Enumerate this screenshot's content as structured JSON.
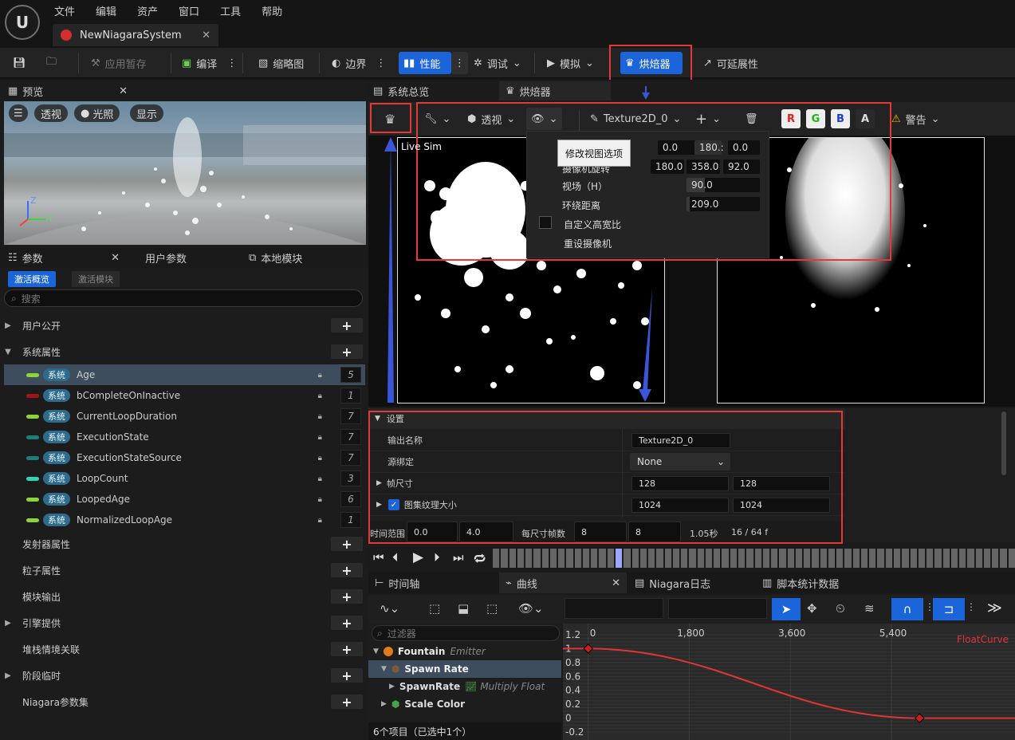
{
  "menubar": {
    "items": [
      "文件",
      "编辑",
      "资产",
      "窗口",
      "工具",
      "帮助"
    ],
    "doc_tab": "NewNiagaraSystem"
  },
  "toolbar": {
    "apply_cache": "应用暂存",
    "compile": "编译",
    "thumbnail": "缩略图",
    "bounds": "边界",
    "performance": "性能",
    "debug": "调试",
    "simulate": "模拟",
    "baker": "烘焙器",
    "scalability": "可延展性"
  },
  "preview": {
    "tab": "预览",
    "perspective": "透视",
    "lighting": "光照",
    "show": "显示",
    "axis_z": "Z",
    "axis_y": "Y"
  },
  "params": {
    "tabs": [
      "参数",
      "用户参数",
      "本地模块"
    ],
    "sub_tabs": [
      "激活概览",
      "激活模块"
    ],
    "search_placeholder": "搜索",
    "categories_top": [
      "用户公开",
      "系统属性"
    ],
    "tag": "系统",
    "rows": [
      {
        "name": "Age",
        "value": "5",
        "color": "#8ed23a"
      },
      {
        "name": "bCompleteOnInactive",
        "value": "1",
        "color": "#a3141a"
      },
      {
        "name": "CurrentLoopDuration",
        "value": "7",
        "color": "#8ed23a"
      },
      {
        "name": "ExecutionState",
        "value": "7",
        "color": "#1e7d78"
      },
      {
        "name": "ExecutionStateSource",
        "value": "7",
        "color": "#1e7d78"
      },
      {
        "name": "LoopCount",
        "value": "3",
        "color": "#2fd6b4"
      },
      {
        "name": "LoopedAge",
        "value": "6",
        "color": "#8ed23a"
      },
      {
        "name": "NormalizedLoopAge",
        "value": "1",
        "color": "#8ed23a"
      }
    ],
    "categories_bottom": [
      "发射器属性",
      "粒子属性",
      "模块输出",
      "引擎提供",
      "堆栈情境关联",
      "阶段临时",
      "Niagara参数集"
    ]
  },
  "viewtabs": {
    "overview": "系统总览",
    "baker": "烘焙器"
  },
  "baker_toolbar": {
    "perspective": "透视",
    "texture": "Texture2D_0",
    "channels": [
      "R",
      "G",
      "B",
      "A"
    ],
    "warning": "警告",
    "live_sim": "Live Sim"
  },
  "popup": {
    "tooltip": "修改视图选项",
    "cam_pos": [
      "0.0",
      "180.:",
      "0.0"
    ],
    "cam_rot_label": "摄像机旋转",
    "cam_rot": [
      "180.0",
      "358.0",
      "92.0"
    ],
    "fov_label": "视场（H）",
    "fov_value": "90.0",
    "fov_fill": 0.25,
    "orbit_label": "环绕距离",
    "orbit_value": "209.0",
    "orbit_fill": 0.04,
    "aspect_label": "自定义高宽比",
    "reset_label": "重设摄像机"
  },
  "settings": {
    "section": "设置",
    "output_name_label": "输出名称",
    "output_name": "Texture2D_0",
    "source_label": "源绑定",
    "source_value": "None",
    "frame_size_label": "帧尺寸",
    "frame_w": "128",
    "frame_h": "128",
    "atlas_label": "图集纹理大小",
    "atlas_w": "1024",
    "atlas_h": "1024",
    "time_label": "时间范围",
    "time_start": "0.0",
    "time_end": "4.0",
    "frames_label": "每尺寸帧数",
    "frames_x": "8",
    "frames_y": "8",
    "seconds": "1.05秒",
    "frame_counter": "16 / 64 f"
  },
  "bottom_tabs": {
    "timeline": "时间轴",
    "curves": "曲线",
    "log": "Niagara日志",
    "script_stats": "脚本统计数据"
  },
  "curves": {
    "filter_placeholder": "过滤器",
    "tree": [
      {
        "label": "Fountain",
        "sub": "Emitter"
      },
      {
        "label": "Spawn Rate",
        "sub": ""
      },
      {
        "label": "SpawnRate",
        "sub": "Multiply Float"
      },
      {
        "label": "Scale Color",
        "sub": ""
      }
    ],
    "status": "6个项目（已选中1个）",
    "curve_name": "FloatCurve",
    "x_ticks": [
      "0",
      "1,800",
      "3,600",
      "5,400"
    ],
    "y_ticks": [
      "1.2",
      "1",
      "0.8",
      "0.6",
      "0.4",
      "0.2",
      "0",
      "-0.2"
    ]
  },
  "chart_data": {
    "type": "line",
    "title": "",
    "xlabel": "",
    "ylabel": "",
    "series": [
      {
        "name": "FloatCurve",
        "x": [
          0,
          5900
        ],
        "values": [
          1,
          0
        ]
      }
    ],
    "xlim": [
      -450,
      7600
    ],
    "ylim": [
      -0.2,
      1.2
    ],
    "x_ticks": [
      0,
      1800,
      3600,
      5400
    ],
    "y_ticks": [
      1.2,
      1,
      0.8,
      0.6,
      0.4,
      0.2,
      0,
      -0.2
    ]
  },
  "colors": {
    "accent": "#1c64d9",
    "highlight_box": "#e53935",
    "annotation_arrow": "#3a56d6",
    "curve": "#e03535"
  }
}
